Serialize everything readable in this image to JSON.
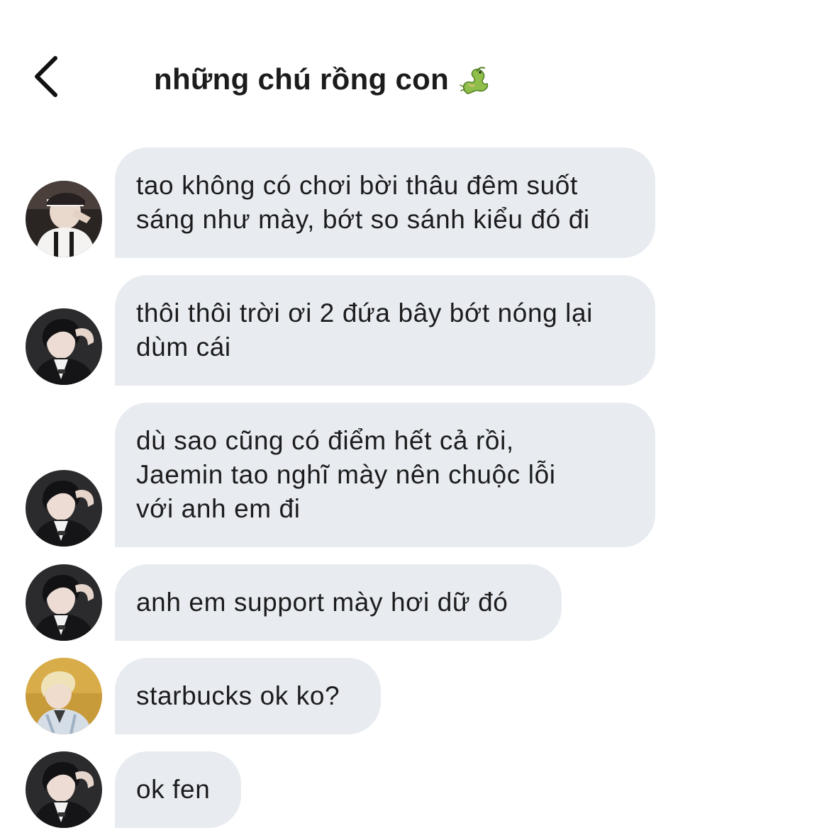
{
  "header": {
    "title": "những chú rồng con",
    "title_emoji_icon": "dragon-icon",
    "back_icon": "chevron-left-icon"
  },
  "colors": {
    "bubble_bg": "#e8ecf0",
    "text": "#1c1c1e",
    "background": "#ffffff"
  },
  "messages": [
    {
      "sender_avatar": "avatar-white-jacket-headband",
      "text": "tao không có chơi bời thâu đêm suốt\nsáng như mày, bớt so sánh kiểu đó đi"
    },
    {
      "sender_avatar": "avatar-dark-hair-black-jacket",
      "text": "thôi thôi trời ơi 2 đứa bây bớt nóng lại\ndùm cái"
    },
    {
      "sender_avatar": "avatar-dark-hair-black-jacket",
      "text": "dù sao cũng có điểm hết cả rồi,\nJaemin tao nghĩ mày nên chuộc lỗi\nvới anh em đi"
    },
    {
      "sender_avatar": "avatar-dark-hair-black-jacket",
      "text": "anh em support mày hơi dữ đó"
    },
    {
      "sender_avatar": "avatar-blonde-denim-jacket",
      "text": "starbucks ok ko?"
    },
    {
      "sender_avatar": "avatar-dark-hair-black-jacket",
      "text": "ok fen"
    }
  ]
}
